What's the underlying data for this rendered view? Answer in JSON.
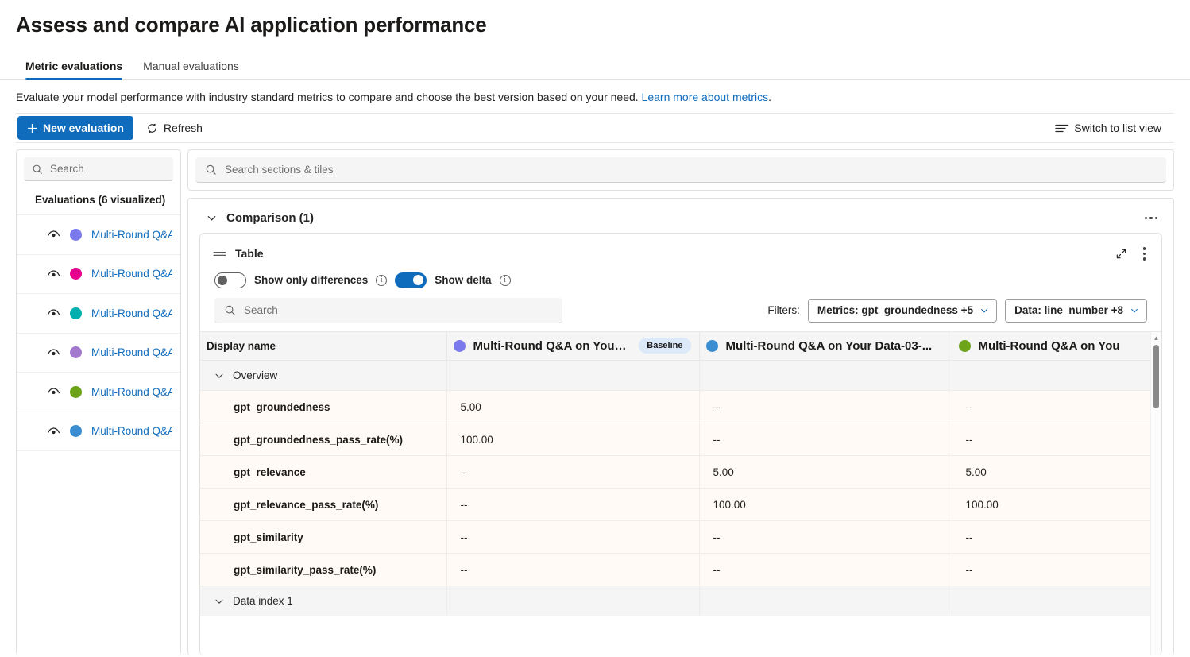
{
  "page": {
    "title": "Assess and compare AI application performance",
    "subtitle_text": "Evaluate your model performance with industry standard metrics to compare and choose the best version based on your need. ",
    "subtitle_link": "Learn more about metrics",
    "subtitle_period": "."
  },
  "tabs": [
    {
      "label": "Metric evaluations",
      "active": true
    },
    {
      "label": "Manual evaluations",
      "active": false
    }
  ],
  "command_bar": {
    "new_evaluation": "New evaluation",
    "refresh": "Refresh",
    "switch_view": "Switch to list view",
    "plus_icon": "plus-icon",
    "refresh_icon": "refresh-icon",
    "list_view_icon": "list-view-icon"
  },
  "sidebar": {
    "search_placeholder": "Search",
    "search_icon": "search-icon",
    "heading": "Evaluations (6 visualized)",
    "items": [
      {
        "label": "Multi-Round Q&A",
        "color": "#7a7aed",
        "eye_icon": "eye-icon"
      },
      {
        "label": "Multi-Round Q&A",
        "color": "#e3008c",
        "eye_icon": "eye-icon"
      },
      {
        "label": "Multi-Round Q&A",
        "color": "#00b0ae",
        "eye_icon": "eye-icon"
      },
      {
        "label": "Multi-Round Q&A",
        "color": "#a379cd",
        "eye_icon": "eye-icon"
      },
      {
        "label": "Multi-Round Q&A",
        "color": "#6ca319",
        "eye_icon": "eye-icon"
      },
      {
        "label": "Multi-Round Q&A",
        "color": "#3a8dd1",
        "eye_icon": "eye-icon"
      }
    ]
  },
  "main": {
    "tile_search_placeholder": "Search sections & tiles",
    "tile_search_icon": "search-icon",
    "section": {
      "title": "Comparison (1)",
      "collapse_icon": "chevron-down-icon",
      "overflow_icon": "more-horizontal-icon"
    },
    "tile": {
      "title": "Table",
      "drag_icon": "drag-handle-icon",
      "expand_icon": "expand-icon",
      "overflow_icon": "more-vertical-icon",
      "toggles": [
        {
          "label": "Show only differences",
          "state": "off",
          "info_icon": "info-icon"
        },
        {
          "label": "Show delta",
          "state": "on",
          "info_icon": "info-icon"
        }
      ],
      "search_placeholder": "Search",
      "search_icon": "search-icon",
      "filters_label": "Filters:",
      "filters": [
        {
          "label": "Metrics: gpt_groundedness +5",
          "chevron": "chevron-down-icon"
        },
        {
          "label": "Data: line_number +8",
          "chevron": "chevron-down-icon"
        }
      ]
    }
  },
  "table_data": {
    "type": "table",
    "columns": [
      {
        "key": "name",
        "header": "Display name",
        "dot_color": null,
        "badge": null
      },
      {
        "key": "c1",
        "header": "Multi-Round Q&A on Your ...",
        "dot_color": "#7a7aed",
        "badge": "Baseline"
      },
      {
        "key": "c2",
        "header": "Multi-Round Q&A on Your Data-03-...",
        "dot_color": "#3a8dd1",
        "badge": null
      },
      {
        "key": "c3",
        "header": "Multi-Round Q&A on You",
        "dot_color": "#6ca319",
        "badge": null
      }
    ],
    "rows": [
      {
        "type": "group",
        "name": "Overview",
        "chevron": "chevron-down-icon",
        "c1": "",
        "c2": "",
        "c3": ""
      },
      {
        "type": "metric",
        "name": "gpt_groundedness",
        "c1": "5.00",
        "c2": "--",
        "c3": "--"
      },
      {
        "type": "metric",
        "name": "gpt_groundedness_pass_rate(%)",
        "c1": "100.00",
        "c2": "--",
        "c3": "--"
      },
      {
        "type": "metric",
        "name": "gpt_relevance",
        "c1": "--",
        "c2": "5.00",
        "c3": "5.00"
      },
      {
        "type": "metric",
        "name": "gpt_relevance_pass_rate(%)",
        "c1": "--",
        "c2": "100.00",
        "c3": "100.00"
      },
      {
        "type": "metric",
        "name": "gpt_similarity",
        "c1": "--",
        "c2": "--",
        "c3": "--"
      },
      {
        "type": "metric",
        "name": "gpt_similarity_pass_rate(%)",
        "c1": "--",
        "c2": "--",
        "c3": "--"
      },
      {
        "type": "group",
        "name": "Data index 1",
        "chevron": "chevron-down-icon",
        "c1": "",
        "c2": "",
        "c3": ""
      }
    ],
    "scrollbar": {
      "arrow": "scroll-up-arrow-icon"
    }
  },
  "colors": {
    "accent": "#0f6cbd",
    "badge_bg": "#dbe9f9",
    "row_tint": "#fffaf5",
    "group_bg": "#f5f5f5"
  }
}
